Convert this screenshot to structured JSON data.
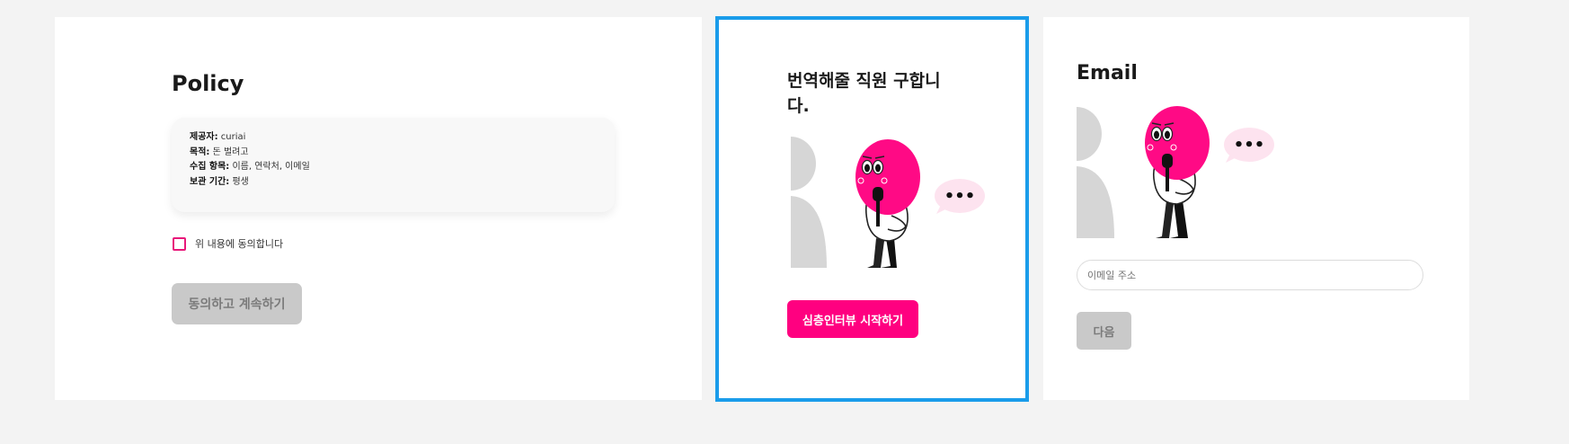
{
  "policy": {
    "title": "Policy",
    "rows": [
      {
        "label": "제공자:",
        "value": " curiai"
      },
      {
        "label": "목적:",
        "value": " 돈 벌려고"
      },
      {
        "label": "수집 항목:",
        "value": " 이름, 연락처, 이메일"
      },
      {
        "label": "보관 기간:",
        "value": " 평생"
      }
    ],
    "agree_label": "위 내용에 동의합니다",
    "agree_checked": false,
    "continue_button": "동의하고 계속하기"
  },
  "recruit": {
    "title": "번역해줄 직원 구합니다.",
    "start_button": "심층인터뷰 시작하기",
    "selected": true,
    "selection_color": "#1a9cea"
  },
  "email": {
    "title": "Email",
    "input_placeholder": "이메일 주소",
    "input_value": "",
    "next_button": "다음"
  },
  "illustration": {
    "character_head_color": "#ff0a85",
    "speech_bubble_color": "#fde3ef",
    "speech_bubble_text": "•••",
    "icons": [
      "microphone-icon",
      "speech-bubble-icon"
    ]
  },
  "colors": {
    "accent": "#ff0080",
    "checkbox_border": "#e8197a",
    "disabled_button": "#c9c9c9",
    "background": "#f3f3f3"
  }
}
